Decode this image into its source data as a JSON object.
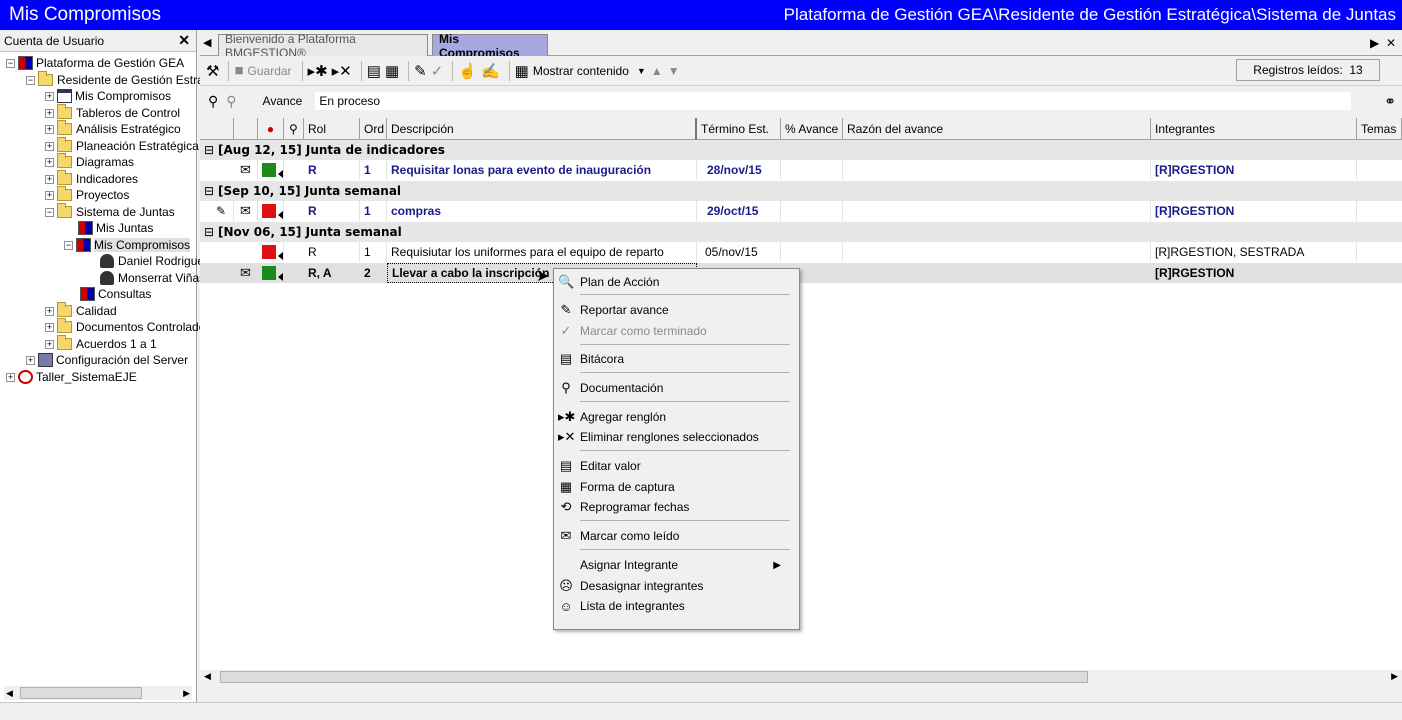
{
  "window": {
    "title": "Mis Compromisos",
    "path": "Plataforma de Gestión GEA\\Residente de Gestión Estratégica\\Sistema de Juntas"
  },
  "left_panel": {
    "header": "Cuenta de Usuario",
    "tree": [
      "Plataforma de Gestión GEA",
      "Residente de Gestión Estrat",
      "Mis Compromisos",
      "Tableros de Control",
      "Análisis Estratégico",
      "Planeación Estratégica",
      "Diagramas",
      "Indicadores",
      "Proyectos",
      "Sistema de Juntas",
      "Mis Juntas",
      "Mis Compromisos",
      "Daniel Rodrigue",
      "Monserrat Viñas",
      "Consultas",
      "Calidad",
      "Documentos Controlado",
      "Acuerdos 1 a 1",
      "Configuración del Server",
      "Taller_SistemaEJE"
    ]
  },
  "tabs": {
    "inactive": "Bienvenido a Plataforma BMGESTION®",
    "active": "Mis Compromisos"
  },
  "toolbar": {
    "save": "Guardar",
    "show_content": "Mostrar contenido",
    "records_label": "Registros leídos:",
    "records_count": "13"
  },
  "filter": {
    "label": "Avance",
    "value": "En proceso"
  },
  "columns": [
    "Rol",
    "Ord",
    "Descripción",
    "Término Est.",
    "% Avance",
    "Razón del avance",
    "Integrantes",
    "Temas"
  ],
  "groups": [
    {
      "title": "[Aug 12, 15]  Junta de indicadores"
    },
    {
      "title": "[Sep 10, 15]  Junta semanal"
    },
    {
      "title": "[Nov 06, 15]  Junta semanal"
    }
  ],
  "rows": [
    {
      "rol": "R",
      "ord": "1",
      "desc": "Requisitar lonas para evento de inauguración",
      "termino": "28/nov/15",
      "integrantes": "[R]RGESTION"
    },
    {
      "rol": "R",
      "ord": "1",
      "desc": "compras",
      "termino": "29/oct/15",
      "integrantes": "[R]RGESTION"
    },
    {
      "rol": "R",
      "ord": "1",
      "desc": "Requisiutar los uniformes para el equipo de reparto",
      "termino": "05/nov/15",
      "integrantes": "[R]RGESTION, SESTRADA"
    },
    {
      "rol": "R, A",
      "ord": "2",
      "desc": "Llevar a cabo la inscripción",
      "termino": "",
      "integrantes": "[R]RGESTION"
    }
  ],
  "context_menu": [
    "Plan de Acción",
    "Reportar avance",
    "Marcar como terminado",
    "Bitácora",
    "Documentación",
    "Agregar renglón",
    "Eliminar renglones seleccionados",
    "Editar valor",
    "Forma de captura",
    "Reprogramar fechas",
    "Marcar como leído",
    "Asignar Integrante",
    "Desasignar integrantes",
    "Lista de integrantes"
  ],
  "colors": {
    "titlebar": "#0000ff",
    "active_tab": "#a8a8e0",
    "status_green": "#1a8a1a",
    "status_red": "#e01010",
    "blue_text": "#1a1a8a"
  }
}
